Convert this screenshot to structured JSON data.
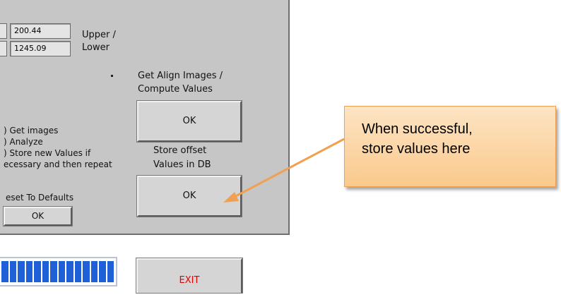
{
  "fields": {
    "upper_value": "200.44",
    "lower_value": "1245.09",
    "label_line1": "Upper /",
    "label_line2": "Lower"
  },
  "align": {
    "caption_line1": "Get Align Images /",
    "caption_line2": "Compute Values",
    "ok_label": "OK"
  },
  "store": {
    "caption_line1": "Store offset",
    "caption_line2": "Values in DB",
    "ok_label": "OK"
  },
  "steps": [
    ") Get images",
    ") Analyze",
    ") Store new Values if",
    "ecessary and then repeat"
  ],
  "reset": {
    "label": "eset To Defaults",
    "ok_label": "OK"
  },
  "progress": {
    "fraction": 1.0
  },
  "exit": {
    "label": "EXIT",
    "color": "#e00000"
  },
  "callout": {
    "line1": "When successful,",
    "line2": "store values here",
    "fill_color": "#fbd4a4",
    "arrow_color": "#f0a050"
  },
  "colors": {
    "panel": "#c6c6c6",
    "progress": "#1f5fd8"
  }
}
